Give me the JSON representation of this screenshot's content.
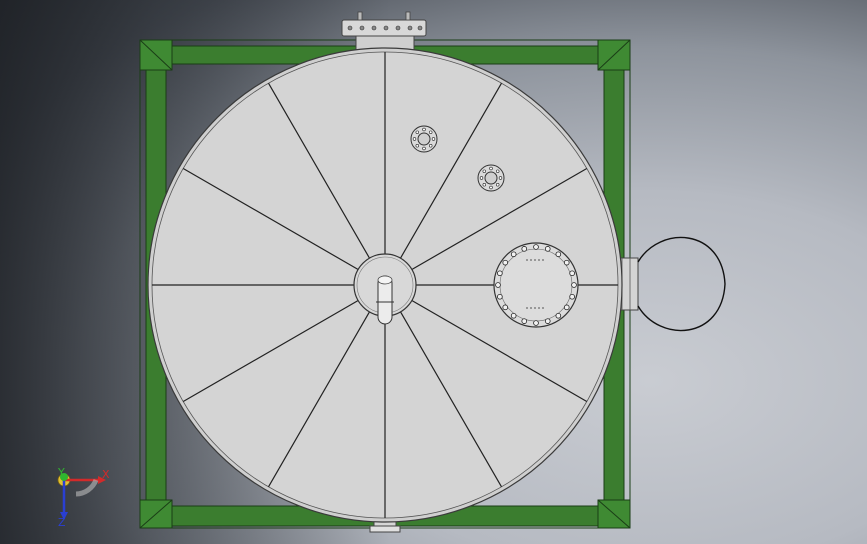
{
  "viewport": {
    "name": "cad-graphics-area"
  },
  "model": {
    "name": "tank-assembly-top-view",
    "frame_color": "#3b7d2f",
    "frame_edge_color": "#1a3d16",
    "shell_color": "#d3d3d3",
    "shell_edge_color": "#3a3a3a",
    "sector_count": 12
  },
  "triad": {
    "x_label": "X",
    "y_label": "Y",
    "z_label": "Z",
    "x_color": "#d22a2a",
    "y_color": "#2fb52f",
    "z_color": "#2a3fd2"
  }
}
